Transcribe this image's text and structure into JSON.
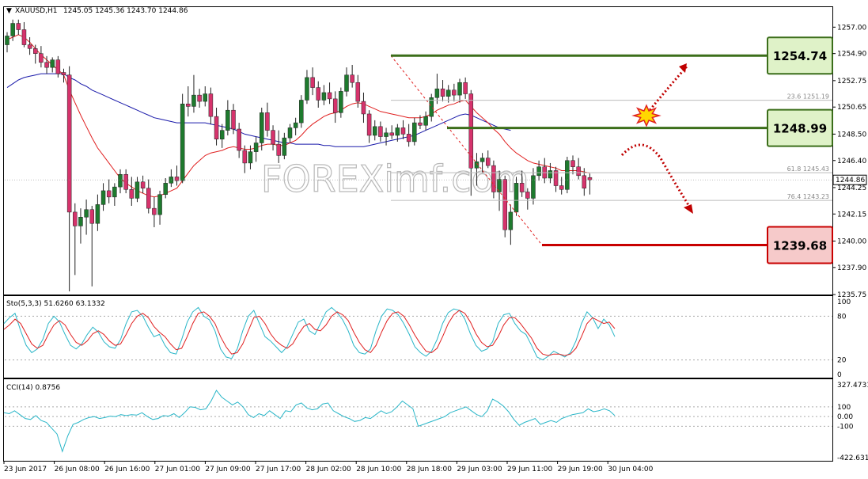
{
  "header": {
    "symbol": "XAUUSD,H1",
    "ohlc": "1245.05 1245.36 1243.70 1244.86"
  },
  "watermark": "FOREXimf.com",
  "colors": {
    "bull": "#1e7a2e",
    "bear": "#d6336c",
    "ma_fast": "#e02020",
    "ma_slow": "#1a1aaa",
    "stoch_main": "#29b6c8",
    "stoch_signal": "#e02020",
    "cci": "#29b6c8",
    "support": "#c80000",
    "resistance": "#3b6e1a"
  },
  "levels": [
    {
      "name": "resistance-1",
      "label": "1254.74",
      "value": 1254.74,
      "role": "resistance"
    },
    {
      "name": "resistance-2",
      "label": "1248.99",
      "value": 1248.99,
      "role": "resistance"
    },
    {
      "name": "support-1",
      "label": "1239.68",
      "value": 1239.68,
      "role": "support"
    }
  ],
  "price_tag": {
    "label": "1244.86",
    "value": 1244.86
  },
  "fib_labels": [
    {
      "label": "23.6 1251.19",
      "value": 1251.19
    },
    {
      "label": "61.8 1245.43",
      "value": 1245.43
    },
    {
      "label": "76.4 1243.23",
      "value": 1243.23
    }
  ],
  "stoch": {
    "title": "Sto(5,3,3) 51.6260 63.1332",
    "axis_labels": [
      "100",
      "80",
      "20",
      "0"
    ],
    "main": [
      70,
      78,
      84,
      60,
      40,
      30,
      35,
      48,
      70,
      80,
      72,
      55,
      40,
      35,
      42,
      55,
      65,
      58,
      45,
      38,
      36,
      48,
      70,
      86,
      88,
      80,
      65,
      52,
      55,
      40,
      30,
      28,
      48,
      72,
      86,
      92,
      80,
      75,
      60,
      35,
      24,
      22,
      35,
      60,
      80,
      88,
      70,
      52,
      46,
      38,
      30,
      38,
      55,
      72,
      76,
      60,
      55,
      70,
      86,
      92,
      85,
      75,
      60,
      40,
      30,
      28,
      35,
      60,
      80,
      90,
      88,
      82,
      70,
      55,
      38,
      30,
      25,
      32,
      48,
      70,
      85,
      90,
      88,
      76,
      56,
      40,
      32,
      35,
      45,
      70,
      82,
      84,
      70,
      60,
      55,
      40,
      24,
      20,
      25,
      32,
      28,
      24,
      30,
      46,
      70,
      86,
      78,
      63,
      76,
      68,
      52
    ],
    "signal": [
      62,
      68,
      76,
      70,
      56,
      42,
      36,
      40,
      55,
      68,
      74,
      68,
      55,
      44,
      40,
      46,
      56,
      60,
      55,
      46,
      40,
      42,
      55,
      70,
      80,
      84,
      78,
      66,
      58,
      52,
      42,
      34,
      36,
      52,
      70,
      84,
      86,
      80,
      70,
      52,
      38,
      28,
      30,
      42,
      60,
      78,
      80,
      70,
      56,
      46,
      40,
      36,
      42,
      55,
      66,
      70,
      62,
      60,
      68,
      80,
      86,
      82,
      74,
      58,
      44,
      34,
      30,
      40,
      58,
      74,
      84,
      86,
      80,
      68,
      54,
      42,
      32,
      30,
      36,
      52,
      70,
      82,
      88,
      84,
      72,
      56,
      44,
      38,
      40,
      52,
      68,
      78,
      78,
      70,
      60,
      50,
      36,
      28,
      26,
      28,
      28,
      26,
      28,
      36,
      52,
      70,
      78,
      74,
      70,
      72,
      63
    ]
  },
  "cci": {
    "title": "CCI(14) 0.8756",
    "axis_labels": [
      "327.4731",
      "100",
      "0.00",
      "-100",
      "-422.6316"
    ],
    "values": [
      40,
      30,
      60,
      20,
      -20,
      -30,
      10,
      -40,
      -60,
      -120,
      -180,
      -360,
      -200,
      -80,
      -60,
      -30,
      -10,
      0,
      -20,
      -10,
      5,
      0,
      20,
      10,
      20,
      15,
      40,
      0,
      -30,
      -20,
      10,
      5,
      30,
      -10,
      40,
      100,
      95,
      70,
      80,
      160,
      270,
      200,
      160,
      120,
      150,
      100,
      20,
      -10,
      30,
      10,
      60,
      20,
      -20,
      60,
      50,
      120,
      140,
      90,
      70,
      80,
      130,
      140,
      60,
      30,
      0,
      -20,
      -50,
      -40,
      -10,
      -20,
      20,
      60,
      30,
      50,
      100,
      160,
      120,
      80,
      -100,
      -80,
      -60,
      -40,
      -20,
      0,
      40,
      60,
      80,
      100,
      60,
      20,
      0,
      60,
      180,
      150,
      110,
      50,
      -30,
      -90,
      -60,
      -40,
      -20,
      -80,
      -60,
      -40,
      -60,
      -20,
      0,
      20,
      30,
      40,
      80,
      50,
      60,
      80,
      60,
      10
    ]
  },
  "chart_data": {
    "type": "candlestick",
    "symbol": "XAUUSD",
    "timeframe": "H1",
    "ylim": [
      1235.75,
      1257.9
    ],
    "y_ticks": [
      1257.0,
      1254.9,
      1252.75,
      1250.65,
      1248.5,
      1246.4,
      1244.25,
      1242.15,
      1240.0,
      1237.9,
      1235.75
    ],
    "x_labels": [
      "23 Jun 2017",
      "26 Jun 08:00",
      "26 Jun 16:00",
      "27 Jun 01:00",
      "27 Jun 09:00",
      "27 Jun 17:00",
      "28 Jun 02:00",
      "28 Jun 10:00",
      "28 Jun 18:00",
      "29 Jun 03:00",
      "29 Jun 11:00",
      "29 Jun 19:00",
      "30 Jun 04:00"
    ],
    "candles": [
      [
        1255.6,
        1256.6,
        1255.0,
        1256.3
      ],
      [
        1256.3,
        1257.6,
        1255.9,
        1257.3
      ],
      [
        1257.3,
        1257.6,
        1256.4,
        1256.8
      ],
      [
        1256.8,
        1257.4,
        1255.4,
        1255.6
      ],
      [
        1255.6,
        1256.2,
        1254.8,
        1255.3
      ],
      [
        1255.3,
        1255.6,
        1254.1,
        1254.9
      ],
      [
        1254.9,
        1255.5,
        1253.8,
        1254.2
      ],
      [
        1254.2,
        1254.7,
        1253.3,
        1253.8
      ],
      [
        1253.8,
        1254.6,
        1253.4,
        1254.4
      ],
      [
        1254.4,
        1254.7,
        1253.0,
        1253.3
      ],
      [
        1253.4,
        1253.7,
        1252.6,
        1253.2
      ],
      [
        1253.2,
        1253.9,
        1236.0,
        1242.3
      ],
      [
        1242.3,
        1243.0,
        1237.3,
        1241.2
      ],
      [
        1241.2,
        1242.6,
        1239.8,
        1241.9
      ],
      [
        1241.9,
        1243.3,
        1240.5,
        1242.5
      ],
      [
        1242.5,
        1242.8,
        1236.4,
        1241.4
      ],
      [
        1241.4,
        1243.7,
        1240.8,
        1242.9
      ],
      [
        1242.9,
        1244.6,
        1242.4,
        1244.0
      ],
      [
        1244.0,
        1244.9,
        1243.0,
        1243.5
      ],
      [
        1243.5,
        1244.6,
        1242.8,
        1244.3
      ],
      [
        1244.3,
        1245.7,
        1243.8,
        1245.3
      ],
      [
        1245.3,
        1245.7,
        1243.8,
        1244.1
      ],
      [
        1244.1,
        1245.1,
        1242.8,
        1243.4
      ],
      [
        1243.4,
        1245.1,
        1243.1,
        1244.7
      ],
      [
        1244.7,
        1245.2,
        1243.8,
        1244.2
      ],
      [
        1244.2,
        1244.9,
        1242.2,
        1242.6
      ],
      [
        1242.6,
        1243.5,
        1241.1,
        1242.1
      ],
      [
        1242.1,
        1244.0,
        1241.3,
        1243.7
      ],
      [
        1243.7,
        1245.0,
        1243.4,
        1244.6
      ],
      [
        1244.6,
        1245.7,
        1244.3,
        1245.1
      ],
      [
        1245.1,
        1246.0,
        1244.4,
        1244.8
      ],
      [
        1244.8,
        1251.7,
        1244.6,
        1250.9
      ],
      [
        1250.9,
        1252.3,
        1249.9,
        1250.7
      ],
      [
        1250.7,
        1253.2,
        1250.2,
        1251.6
      ],
      [
        1251.6,
        1252.1,
        1250.6,
        1251.1
      ],
      [
        1251.1,
        1252.3,
        1250.7,
        1251.7
      ],
      [
        1251.7,
        1252.2,
        1249.3,
        1249.9
      ],
      [
        1249.9,
        1250.6,
        1247.6,
        1248.1
      ],
      [
        1248.1,
        1249.3,
        1247.4,
        1248.8
      ],
      [
        1248.8,
        1251.2,
        1248.4,
        1250.4
      ],
      [
        1250.4,
        1250.9,
        1248.5,
        1248.9
      ],
      [
        1248.9,
        1249.4,
        1246.6,
        1247.2
      ],
      [
        1247.2,
        1247.6,
        1245.4,
        1246.2
      ],
      [
        1246.2,
        1247.6,
        1245.7,
        1247.1
      ],
      [
        1247.1,
        1248.3,
        1246.3,
        1247.8
      ],
      [
        1247.8,
        1250.6,
        1247.2,
        1250.2
      ],
      [
        1250.2,
        1251.0,
        1248.3,
        1248.8
      ],
      [
        1248.8,
        1249.2,
        1247.2,
        1247.7
      ],
      [
        1247.7,
        1248.8,
        1246.2,
        1246.8
      ],
      [
        1246.8,
        1248.6,
        1246.5,
        1248.2
      ],
      [
        1248.2,
        1249.3,
        1247.8,
        1249.0
      ],
      [
        1249.0,
        1249.8,
        1248.4,
        1249.4
      ],
      [
        1249.4,
        1251.6,
        1249.0,
        1251.2
      ],
      [
        1251.2,
        1253.6,
        1250.9,
        1253.0
      ],
      [
        1253.0,
        1253.8,
        1251.6,
        1252.2
      ],
      [
        1252.2,
        1252.7,
        1250.6,
        1251.2
      ],
      [
        1251.2,
        1252.4,
        1250.8,
        1251.8
      ],
      [
        1251.8,
        1252.6,
        1250.9,
        1251.3
      ],
      [
        1251.3,
        1251.9,
        1249.4,
        1250.2
      ],
      [
        1250.2,
        1252.2,
        1249.8,
        1251.9
      ],
      [
        1251.9,
        1253.8,
        1251.5,
        1253.2
      ],
      [
        1253.2,
        1254.0,
        1252.2,
        1252.6
      ],
      [
        1252.6,
        1253.2,
        1250.6,
        1251.1
      ],
      [
        1251.1,
        1251.8,
        1249.4,
        1250.1
      ],
      [
        1250.1,
        1250.4,
        1247.8,
        1248.4
      ],
      [
        1248.4,
        1249.6,
        1248.0,
        1249.1
      ],
      [
        1249.1,
        1249.5,
        1247.9,
        1248.3
      ],
      [
        1248.3,
        1249.0,
        1247.6,
        1248.6
      ],
      [
        1248.6,
        1249.2,
        1248.1,
        1248.4
      ],
      [
        1248.4,
        1249.3,
        1247.9,
        1249.0
      ],
      [
        1249.0,
        1249.6,
        1248.1,
        1248.5
      ],
      [
        1248.5,
        1249.3,
        1247.5,
        1247.9
      ],
      [
        1247.9,
        1249.8,
        1247.6,
        1249.4
      ],
      [
        1249.4,
        1250.0,
        1248.9,
        1249.2
      ],
      [
        1249.2,
        1250.3,
        1248.8,
        1249.9
      ],
      [
        1249.9,
        1251.7,
        1249.5,
        1251.4
      ],
      [
        1251.4,
        1253.3,
        1250.9,
        1252.1
      ],
      [
        1252.1,
        1252.8,
        1251.1,
        1251.5
      ],
      [
        1251.5,
        1252.4,
        1251.0,
        1252.0
      ],
      [
        1252.0,
        1252.5,
        1251.1,
        1251.6
      ],
      [
        1251.6,
        1252.9,
        1251.0,
        1252.6
      ],
      [
        1252.6,
        1253.0,
        1251.3,
        1251.7
      ],
      [
        1251.7,
        1252.0,
        1243.6,
        1245.8
      ],
      [
        1245.8,
        1247.0,
        1244.4,
        1246.3
      ],
      [
        1246.3,
        1247.0,
        1245.4,
        1246.6
      ],
      [
        1246.6,
        1247.2,
        1245.8,
        1246.0
      ],
      [
        1246.0,
        1246.4,
        1243.4,
        1243.9
      ],
      [
        1243.9,
        1245.6,
        1242.4,
        1244.9
      ],
      [
        1244.9,
        1245.2,
        1240.3,
        1240.9
      ],
      [
        1240.9,
        1242.9,
        1239.7,
        1242.3
      ],
      [
        1242.3,
        1245.1,
        1242.0,
        1244.6
      ],
      [
        1244.6,
        1245.6,
        1243.5,
        1243.9
      ],
      [
        1243.9,
        1244.2,
        1242.5,
        1243.4
      ],
      [
        1243.4,
        1245.8,
        1242.9,
        1245.2
      ],
      [
        1245.2,
        1246.4,
        1244.8,
        1245.9
      ],
      [
        1245.9,
        1246.6,
        1244.6,
        1245.0
      ],
      [
        1245.0,
        1246.2,
        1244.6,
        1245.6
      ],
      [
        1245.6,
        1245.9,
        1243.9,
        1244.4
      ],
      [
        1244.4,
        1245.1,
        1243.7,
        1244.1
      ],
      [
        1244.1,
        1246.7,
        1243.8,
        1246.4
      ],
      [
        1246.4,
        1246.8,
        1245.3,
        1245.9
      ],
      [
        1245.9,
        1246.6,
        1244.9,
        1245.2
      ],
      [
        1245.2,
        1245.8,
        1243.6,
        1244.2
      ],
      [
        1245.05,
        1245.36,
        1243.7,
        1244.86
      ]
    ],
    "ma_fast": [
      1256.0,
      1256.2,
      1256.4,
      1256.2,
      1255.8,
      1255.3,
      1254.8,
      1254.4,
      1254.0,
      1253.6,
      1253.2,
      1252.0,
      1251.0,
      1250.0,
      1249.1,
      1248.2,
      1247.4,
      1246.8,
      1246.2,
      1245.6,
      1245.0,
      1244.6,
      1244.3,
      1244.0,
      1243.8,
      1243.6,
      1243.5,
      1243.6,
      1243.8,
      1244.0,
      1244.2,
      1244.8,
      1245.4,
      1246.0,
      1246.4,
      1246.8,
      1247.0,
      1247.1,
      1247.2,
      1247.4,
      1247.5,
      1247.4,
      1247.3,
      1247.3,
      1247.4,
      1247.6,
      1247.7,
      1247.7,
      1247.6,
      1247.6,
      1247.8,
      1248.0,
      1248.4,
      1248.9,
      1249.3,
      1249.6,
      1249.9,
      1250.1,
      1250.2,
      1250.4,
      1250.7,
      1250.9,
      1251.0,
      1250.9,
      1250.7,
      1250.5,
      1250.3,
      1250.2,
      1250.1,
      1250.0,
      1249.9,
      1249.8,
      1249.8,
      1249.8,
      1249.9,
      1250.1,
      1250.4,
      1250.6,
      1250.8,
      1250.9,
      1251.1,
      1251.2,
      1250.7,
      1250.2,
      1249.8,
      1249.4,
      1248.9,
      1248.5,
      1247.9,
      1247.4,
      1247.0,
      1246.7,
      1246.4,
      1246.2,
      1246.1,
      1246.0,
      1245.9,
      1245.8,
      1245.6,
      1245.6,
      1245.6,
      1245.6,
      1245.5,
      1245.4
    ],
    "ma_slow": [
      1252.2,
      1252.5,
      1252.8,
      1253.0,
      1253.1,
      1253.2,
      1253.3,
      1253.3,
      1253.3,
      1253.3,
      1253.3,
      1253.0,
      1252.8,
      1252.5,
      1252.3,
      1252.0,
      1251.8,
      1251.6,
      1251.4,
      1251.2,
      1251.0,
      1250.8,
      1250.6,
      1250.4,
      1250.2,
      1250.0,
      1249.8,
      1249.7,
      1249.6,
      1249.5,
      1249.4,
      1249.4,
      1249.4,
      1249.4,
      1249.4,
      1249.4,
      1249.3,
      1249.2,
      1249.1,
      1249.0,
      1248.9,
      1248.7,
      1248.5,
      1248.4,
      1248.3,
      1248.2,
      1248.1,
      1248.0,
      1247.9,
      1247.8,
      1247.8,
      1247.7,
      1247.7,
      1247.7,
      1247.7,
      1247.7,
      1247.6,
      1247.6,
      1247.5,
      1247.5,
      1247.5,
      1247.5,
      1247.5,
      1247.5,
      1247.6,
      1247.7,
      1247.8,
      1247.9,
      1248.0,
      1248.1,
      1248.2,
      1248.3,
      1248.4,
      1248.6,
      1248.8,
      1249.0,
      1249.2,
      1249.4,
      1249.6,
      1249.8,
      1250.0,
      1250.1,
      1250.0,
      1249.8,
      1249.6,
      1249.4,
      1249.2,
      1249.0,
      1248.9,
      1248.8
    ]
  }
}
